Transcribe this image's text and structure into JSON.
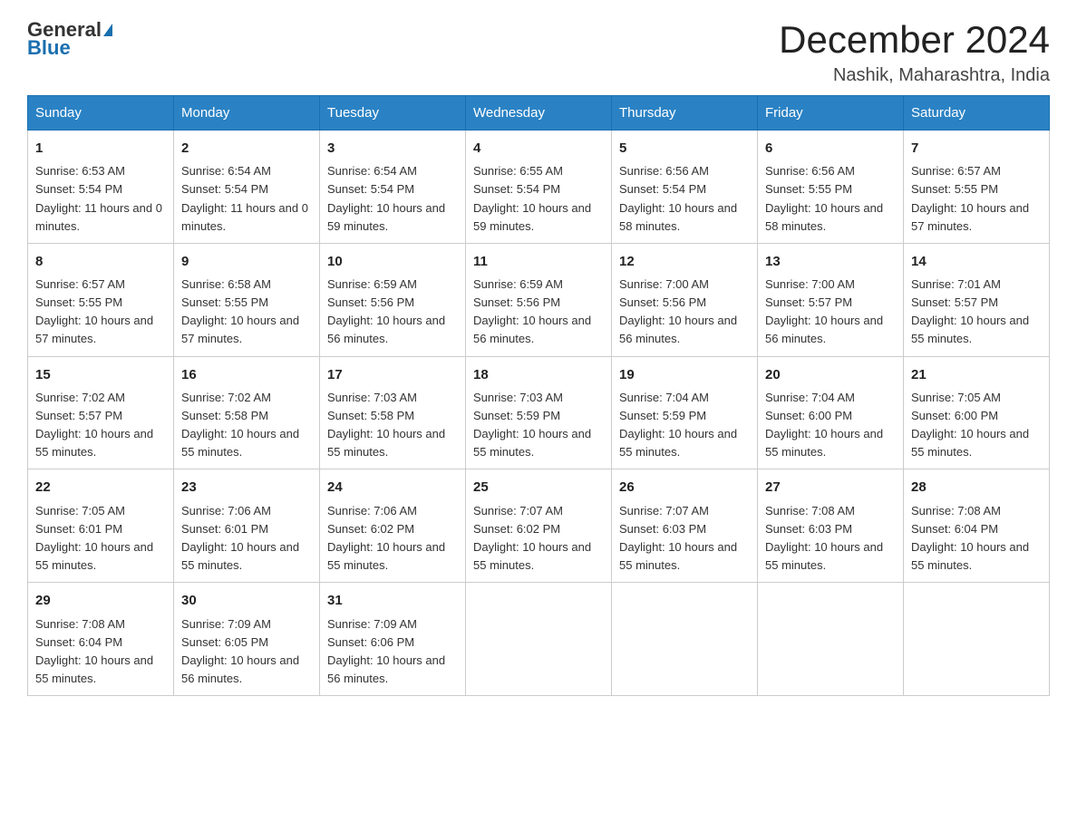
{
  "logo": {
    "general": "General",
    "blue": "Blue"
  },
  "title": {
    "month": "December 2024",
    "location": "Nashik, Maharashtra, India"
  },
  "weekdays": [
    "Sunday",
    "Monday",
    "Tuesday",
    "Wednesday",
    "Thursday",
    "Friday",
    "Saturday"
  ],
  "weeks": [
    [
      {
        "day": "1",
        "sunrise": "6:53 AM",
        "sunset": "5:54 PM",
        "daylight": "11 hours and 0 minutes."
      },
      {
        "day": "2",
        "sunrise": "6:54 AM",
        "sunset": "5:54 PM",
        "daylight": "11 hours and 0 minutes."
      },
      {
        "day": "3",
        "sunrise": "6:54 AM",
        "sunset": "5:54 PM",
        "daylight": "10 hours and 59 minutes."
      },
      {
        "day": "4",
        "sunrise": "6:55 AM",
        "sunset": "5:54 PM",
        "daylight": "10 hours and 59 minutes."
      },
      {
        "day": "5",
        "sunrise": "6:56 AM",
        "sunset": "5:54 PM",
        "daylight": "10 hours and 58 minutes."
      },
      {
        "day": "6",
        "sunrise": "6:56 AM",
        "sunset": "5:55 PM",
        "daylight": "10 hours and 58 minutes."
      },
      {
        "day": "7",
        "sunrise": "6:57 AM",
        "sunset": "5:55 PM",
        "daylight": "10 hours and 57 minutes."
      }
    ],
    [
      {
        "day": "8",
        "sunrise": "6:57 AM",
        "sunset": "5:55 PM",
        "daylight": "10 hours and 57 minutes."
      },
      {
        "day": "9",
        "sunrise": "6:58 AM",
        "sunset": "5:55 PM",
        "daylight": "10 hours and 57 minutes."
      },
      {
        "day": "10",
        "sunrise": "6:59 AM",
        "sunset": "5:56 PM",
        "daylight": "10 hours and 56 minutes."
      },
      {
        "day": "11",
        "sunrise": "6:59 AM",
        "sunset": "5:56 PM",
        "daylight": "10 hours and 56 minutes."
      },
      {
        "day": "12",
        "sunrise": "7:00 AM",
        "sunset": "5:56 PM",
        "daylight": "10 hours and 56 minutes."
      },
      {
        "day": "13",
        "sunrise": "7:00 AM",
        "sunset": "5:57 PM",
        "daylight": "10 hours and 56 minutes."
      },
      {
        "day": "14",
        "sunrise": "7:01 AM",
        "sunset": "5:57 PM",
        "daylight": "10 hours and 55 minutes."
      }
    ],
    [
      {
        "day": "15",
        "sunrise": "7:02 AM",
        "sunset": "5:57 PM",
        "daylight": "10 hours and 55 minutes."
      },
      {
        "day": "16",
        "sunrise": "7:02 AM",
        "sunset": "5:58 PM",
        "daylight": "10 hours and 55 minutes."
      },
      {
        "day": "17",
        "sunrise": "7:03 AM",
        "sunset": "5:58 PM",
        "daylight": "10 hours and 55 minutes."
      },
      {
        "day": "18",
        "sunrise": "7:03 AM",
        "sunset": "5:59 PM",
        "daylight": "10 hours and 55 minutes."
      },
      {
        "day": "19",
        "sunrise": "7:04 AM",
        "sunset": "5:59 PM",
        "daylight": "10 hours and 55 minutes."
      },
      {
        "day": "20",
        "sunrise": "7:04 AM",
        "sunset": "6:00 PM",
        "daylight": "10 hours and 55 minutes."
      },
      {
        "day": "21",
        "sunrise": "7:05 AM",
        "sunset": "6:00 PM",
        "daylight": "10 hours and 55 minutes."
      }
    ],
    [
      {
        "day": "22",
        "sunrise": "7:05 AM",
        "sunset": "6:01 PM",
        "daylight": "10 hours and 55 minutes."
      },
      {
        "day": "23",
        "sunrise": "7:06 AM",
        "sunset": "6:01 PM",
        "daylight": "10 hours and 55 minutes."
      },
      {
        "day": "24",
        "sunrise": "7:06 AM",
        "sunset": "6:02 PM",
        "daylight": "10 hours and 55 minutes."
      },
      {
        "day": "25",
        "sunrise": "7:07 AM",
        "sunset": "6:02 PM",
        "daylight": "10 hours and 55 minutes."
      },
      {
        "day": "26",
        "sunrise": "7:07 AM",
        "sunset": "6:03 PM",
        "daylight": "10 hours and 55 minutes."
      },
      {
        "day": "27",
        "sunrise": "7:08 AM",
        "sunset": "6:03 PM",
        "daylight": "10 hours and 55 minutes."
      },
      {
        "day": "28",
        "sunrise": "7:08 AM",
        "sunset": "6:04 PM",
        "daylight": "10 hours and 55 minutes."
      }
    ],
    [
      {
        "day": "29",
        "sunrise": "7:08 AM",
        "sunset": "6:04 PM",
        "daylight": "10 hours and 55 minutes."
      },
      {
        "day": "30",
        "sunrise": "7:09 AM",
        "sunset": "6:05 PM",
        "daylight": "10 hours and 56 minutes."
      },
      {
        "day": "31",
        "sunrise": "7:09 AM",
        "sunset": "6:06 PM",
        "daylight": "10 hours and 56 minutes."
      },
      null,
      null,
      null,
      null
    ]
  ]
}
